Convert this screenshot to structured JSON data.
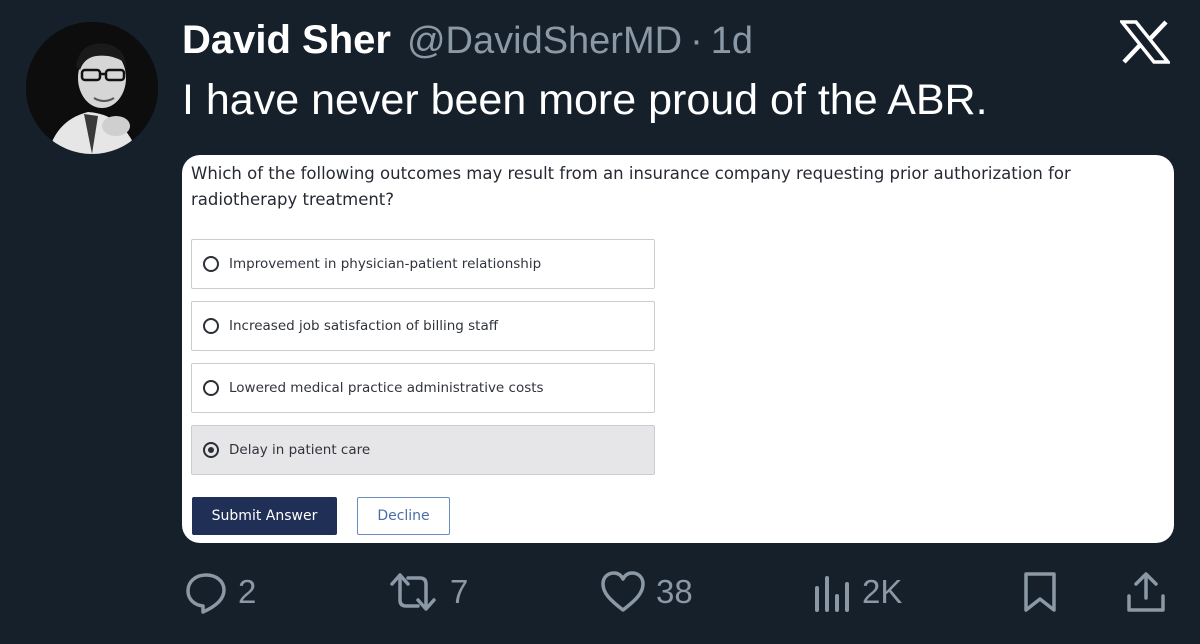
{
  "author": {
    "name": "David Sher",
    "handle": "@DavidSherMD",
    "separator": "·",
    "age": "1d"
  },
  "tweet": {
    "text": "I have never been more proud of the ABR."
  },
  "quiz": {
    "question": "Which of the following outcomes may result from an insurance company requesting prior authorization for radiotherapy treatment?",
    "options": [
      {
        "label": "Improvement in physician-patient relationship",
        "selected": false
      },
      {
        "label": "Increased job satisfaction of billing staff",
        "selected": false
      },
      {
        "label": "Lowered medical practice administrative costs",
        "selected": false
      },
      {
        "label": "Delay in patient care",
        "selected": true
      }
    ],
    "submit_label": "Submit Answer",
    "decline_label": "Decline"
  },
  "actions": {
    "replies": "2",
    "reposts": "7",
    "likes": "38",
    "views": "2K"
  },
  "icons": {
    "brand": "x-logo-icon",
    "reply": "reply-icon",
    "repost": "repost-icon",
    "like": "heart-icon",
    "views": "views-icon",
    "bookmark": "bookmark-icon",
    "share": "share-icon"
  },
  "colors": {
    "background": "#15202b",
    "secondary_text": "#8b98a5",
    "submit_button": "#1f2f55",
    "decline_text": "#4a6ea8"
  }
}
